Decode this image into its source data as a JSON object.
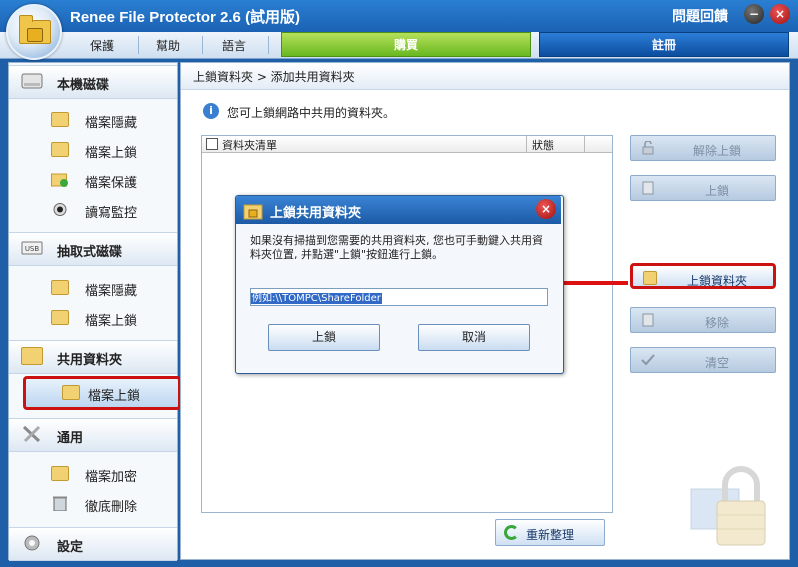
{
  "app": {
    "title": "Renee File Protector 2.6 (試用版)",
    "help": "問題回饋",
    "min": "−",
    "close": "×"
  },
  "menu": {
    "items": [
      "保護",
      "幫助",
      "語言"
    ],
    "buy": "購買",
    "register": "註冊"
  },
  "sidebar": {
    "sections": [
      {
        "title": "本機磁碟",
        "items": [
          "檔案隱藏",
          "檔案上鎖",
          "檔案保護",
          "讀寫監控"
        ]
      },
      {
        "title": "抽取式磁碟",
        "items": [
          "檔案隱藏",
          "檔案上鎖"
        ]
      },
      {
        "title": "共用資料夾",
        "items": [
          "檔案上鎖"
        ]
      },
      {
        "title": "通用",
        "items": [
          "檔案加密",
          "徹底刪除"
        ]
      },
      {
        "title": "設定",
        "items": []
      }
    ],
    "usb_badge": "USB"
  },
  "main": {
    "breadcrumb": "上鎖資料夾 > 添加共用資料夾",
    "info_icon": "i",
    "info": "您可上鎖網路中共用的資料夾。",
    "list": {
      "col_name": "資料夾清單",
      "col_status": "狀態"
    },
    "buttons": [
      "解除上鎖",
      "上鎖",
      "上鎖資料夾",
      "移除",
      "清空"
    ],
    "refresh": "重新整理"
  },
  "dialog": {
    "title": "上鎖共用資料夾",
    "close": "×",
    "message": "如果沒有掃描到您需要的共用資料夾, 您也可手動鍵入共用資料夾位置, 并點選\"上鎖\"按鈕進行上鎖。",
    "input_value": "例如:\\\\TOMPC\\ShareFolder",
    "ok": "上鎖",
    "cancel": "取消"
  },
  "colors": {
    "highlight": "#cc1111",
    "buy": "#7cc42a",
    "register": "#1560c0"
  }
}
